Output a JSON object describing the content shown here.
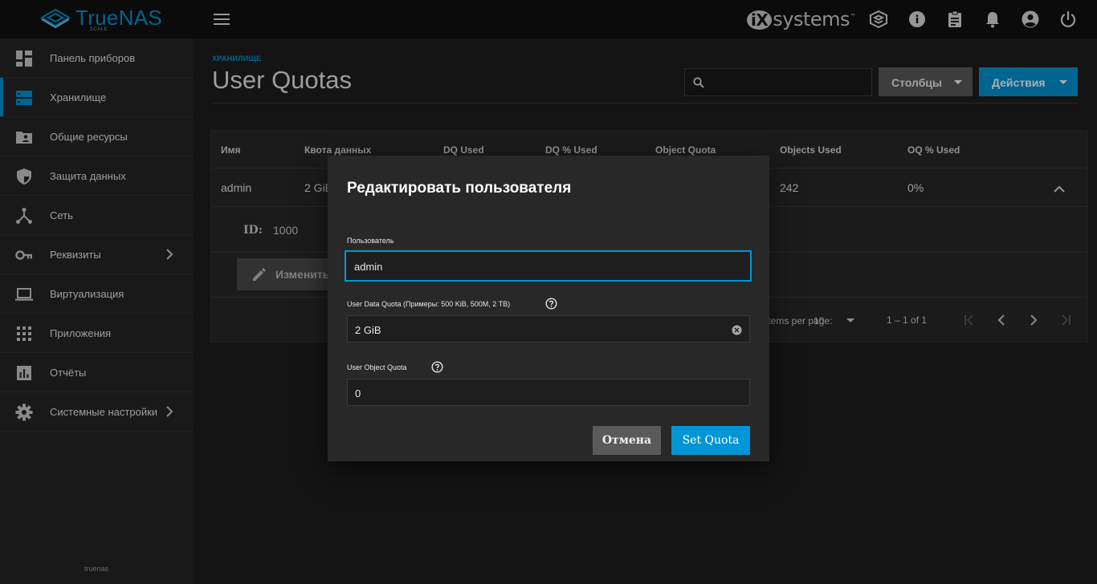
{
  "brand": {
    "name": "TrueNAS",
    "sub": "SCALE"
  },
  "vendor_logo": {
    "prefix": "iX",
    "text": "systems",
    "tm": "™"
  },
  "topbar_icons": [
    "truecommand-icon",
    "info-icon",
    "clipboard-icon",
    "bell-icon",
    "account-icon",
    "power-icon"
  ],
  "sidebar": {
    "items": [
      {
        "label": "Панель приборов",
        "icon": "dashboard-icon"
      },
      {
        "label": "Хранилище",
        "icon": "storage-icon"
      },
      {
        "label": "Общие ресурсы",
        "icon": "shares-icon"
      },
      {
        "label": "Защита данных",
        "icon": "shield-icon"
      },
      {
        "label": "Сеть",
        "icon": "network-icon"
      },
      {
        "label": "Реквизиты",
        "icon": "key-icon"
      },
      {
        "label": "Виртуализация",
        "icon": "laptop-icon"
      },
      {
        "label": "Приложения",
        "icon": "apps-icon"
      },
      {
        "label": "Отчёты",
        "icon": "reports-icon"
      },
      {
        "label": "Системные настройки",
        "icon": "gear-icon"
      }
    ],
    "active_index": 1,
    "footer": "truenas"
  },
  "page": {
    "breadcrumb": "ХРАНИЛИЩЕ",
    "title": "User Quotas",
    "search_value": "",
    "columns_button": "Столбцы",
    "actions_button": "Действия"
  },
  "table": {
    "headers": [
      "Имя",
      "Квота данных",
      "DQ Used",
      "DQ % Used",
      "Object Quota",
      "Objects Used",
      "OQ % Used"
    ],
    "row": {
      "name": "admin",
      "data_quota": "2 GiB",
      "objects_used": "242",
      "oq_percent": "0%"
    },
    "detail": {
      "id_label": "ID:",
      "id_value": "1000",
      "edit_button": "Изменить"
    },
    "paginator": {
      "per_page_label": "Items per page:",
      "per_page_value": "10",
      "range": "1 – 1 of 1"
    }
  },
  "dialog": {
    "title": "Редактировать пользователя",
    "user_label": "Пользователь",
    "user_value": "admin",
    "data_quota_label": "User Data Quota (Примеры: 500 KiB, 500M, 2 TB)",
    "data_quota_value": "2 GiB",
    "object_quota_label": "User Object Quota",
    "object_quota_value": "0",
    "cancel_button": "Отмена",
    "submit_button": "Set Quota"
  },
  "colors": {
    "accent": "#0095d5",
    "background": "#1e1e1e",
    "sidebar": "#262626",
    "topbar": "#111111"
  }
}
